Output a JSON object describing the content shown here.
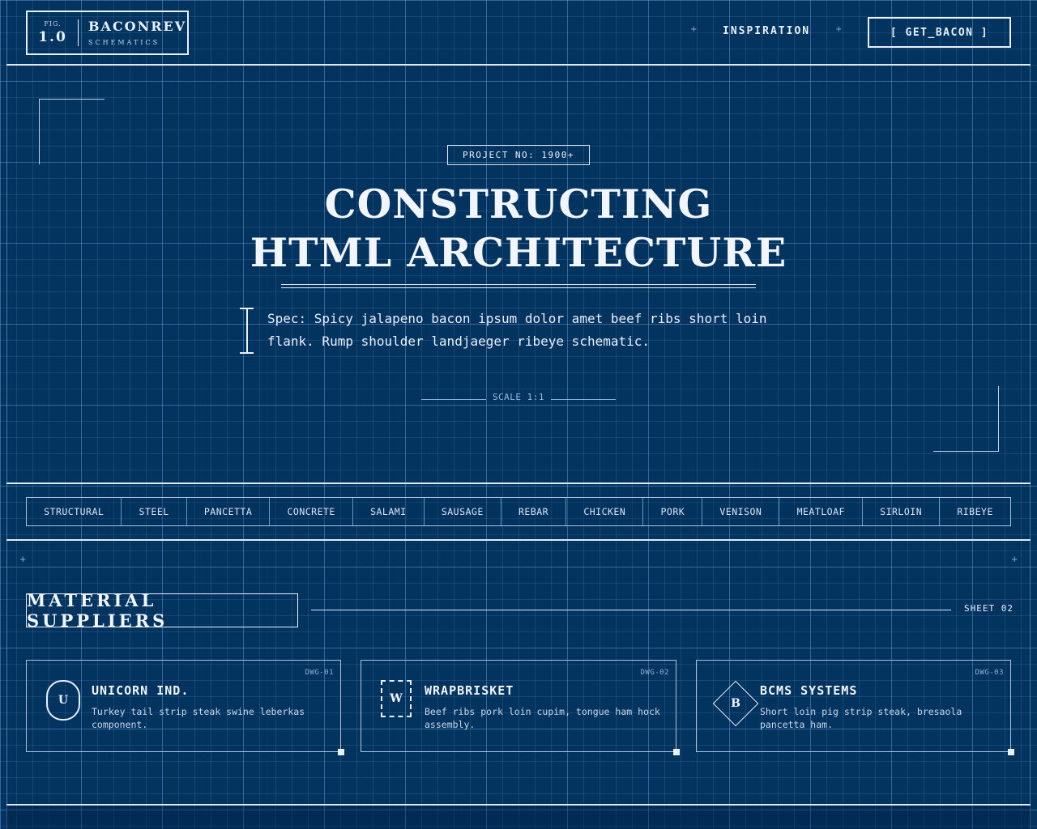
{
  "header": {
    "logo_fig_label": "FIG.",
    "logo_fig_number": "1.0",
    "brand": "BACONREV",
    "brand_sub": "SCHEMATICS",
    "nav_link": "INSPIRATION",
    "nav_plus": "+",
    "cta_label": "[ GET_BACON ]"
  },
  "hero": {
    "project_tag": "PROJECT NO: 1900+",
    "title_line1": "CONSTRUCTING",
    "title_line2": "HTML ARCHITECTURE",
    "spec": "Spec: Spicy jalapeno bacon ipsum dolor amet beef ribs short loin flank. Rump shoulder landjaeger ribeye schematic.",
    "scale_label": "SCALE 1:1"
  },
  "tags": [
    "STRUCTURAL",
    "STEEL",
    "PANCETTA",
    "CONCRETE",
    "SALAMI",
    "SAUSAGE",
    "REBAR",
    "CHICKEN",
    "PORK",
    "VENISON",
    "MEATLOAF",
    "SIRLOIN",
    "RIBEYE"
  ],
  "suppliers": {
    "title": "MATERIAL SUPPLIERS",
    "sheet": "SHEET 02",
    "plus": "+",
    "cards": [
      {
        "dwg": "DWG-01",
        "badge": "U",
        "name": "UNICORN IND.",
        "desc": "Turkey tail strip steak swine leberkas component."
      },
      {
        "dwg": "DWG-02",
        "badge": "W",
        "name": "WRAPBRISKET",
        "desc": "Beef ribs pork loin cupim, tongue ham hock assembly."
      },
      {
        "dwg": "DWG-03",
        "badge": "B",
        "name": "BCMS SYSTEMS",
        "desc": "Short loin pig strip steak, bresaola pancetta ham."
      }
    ]
  }
}
